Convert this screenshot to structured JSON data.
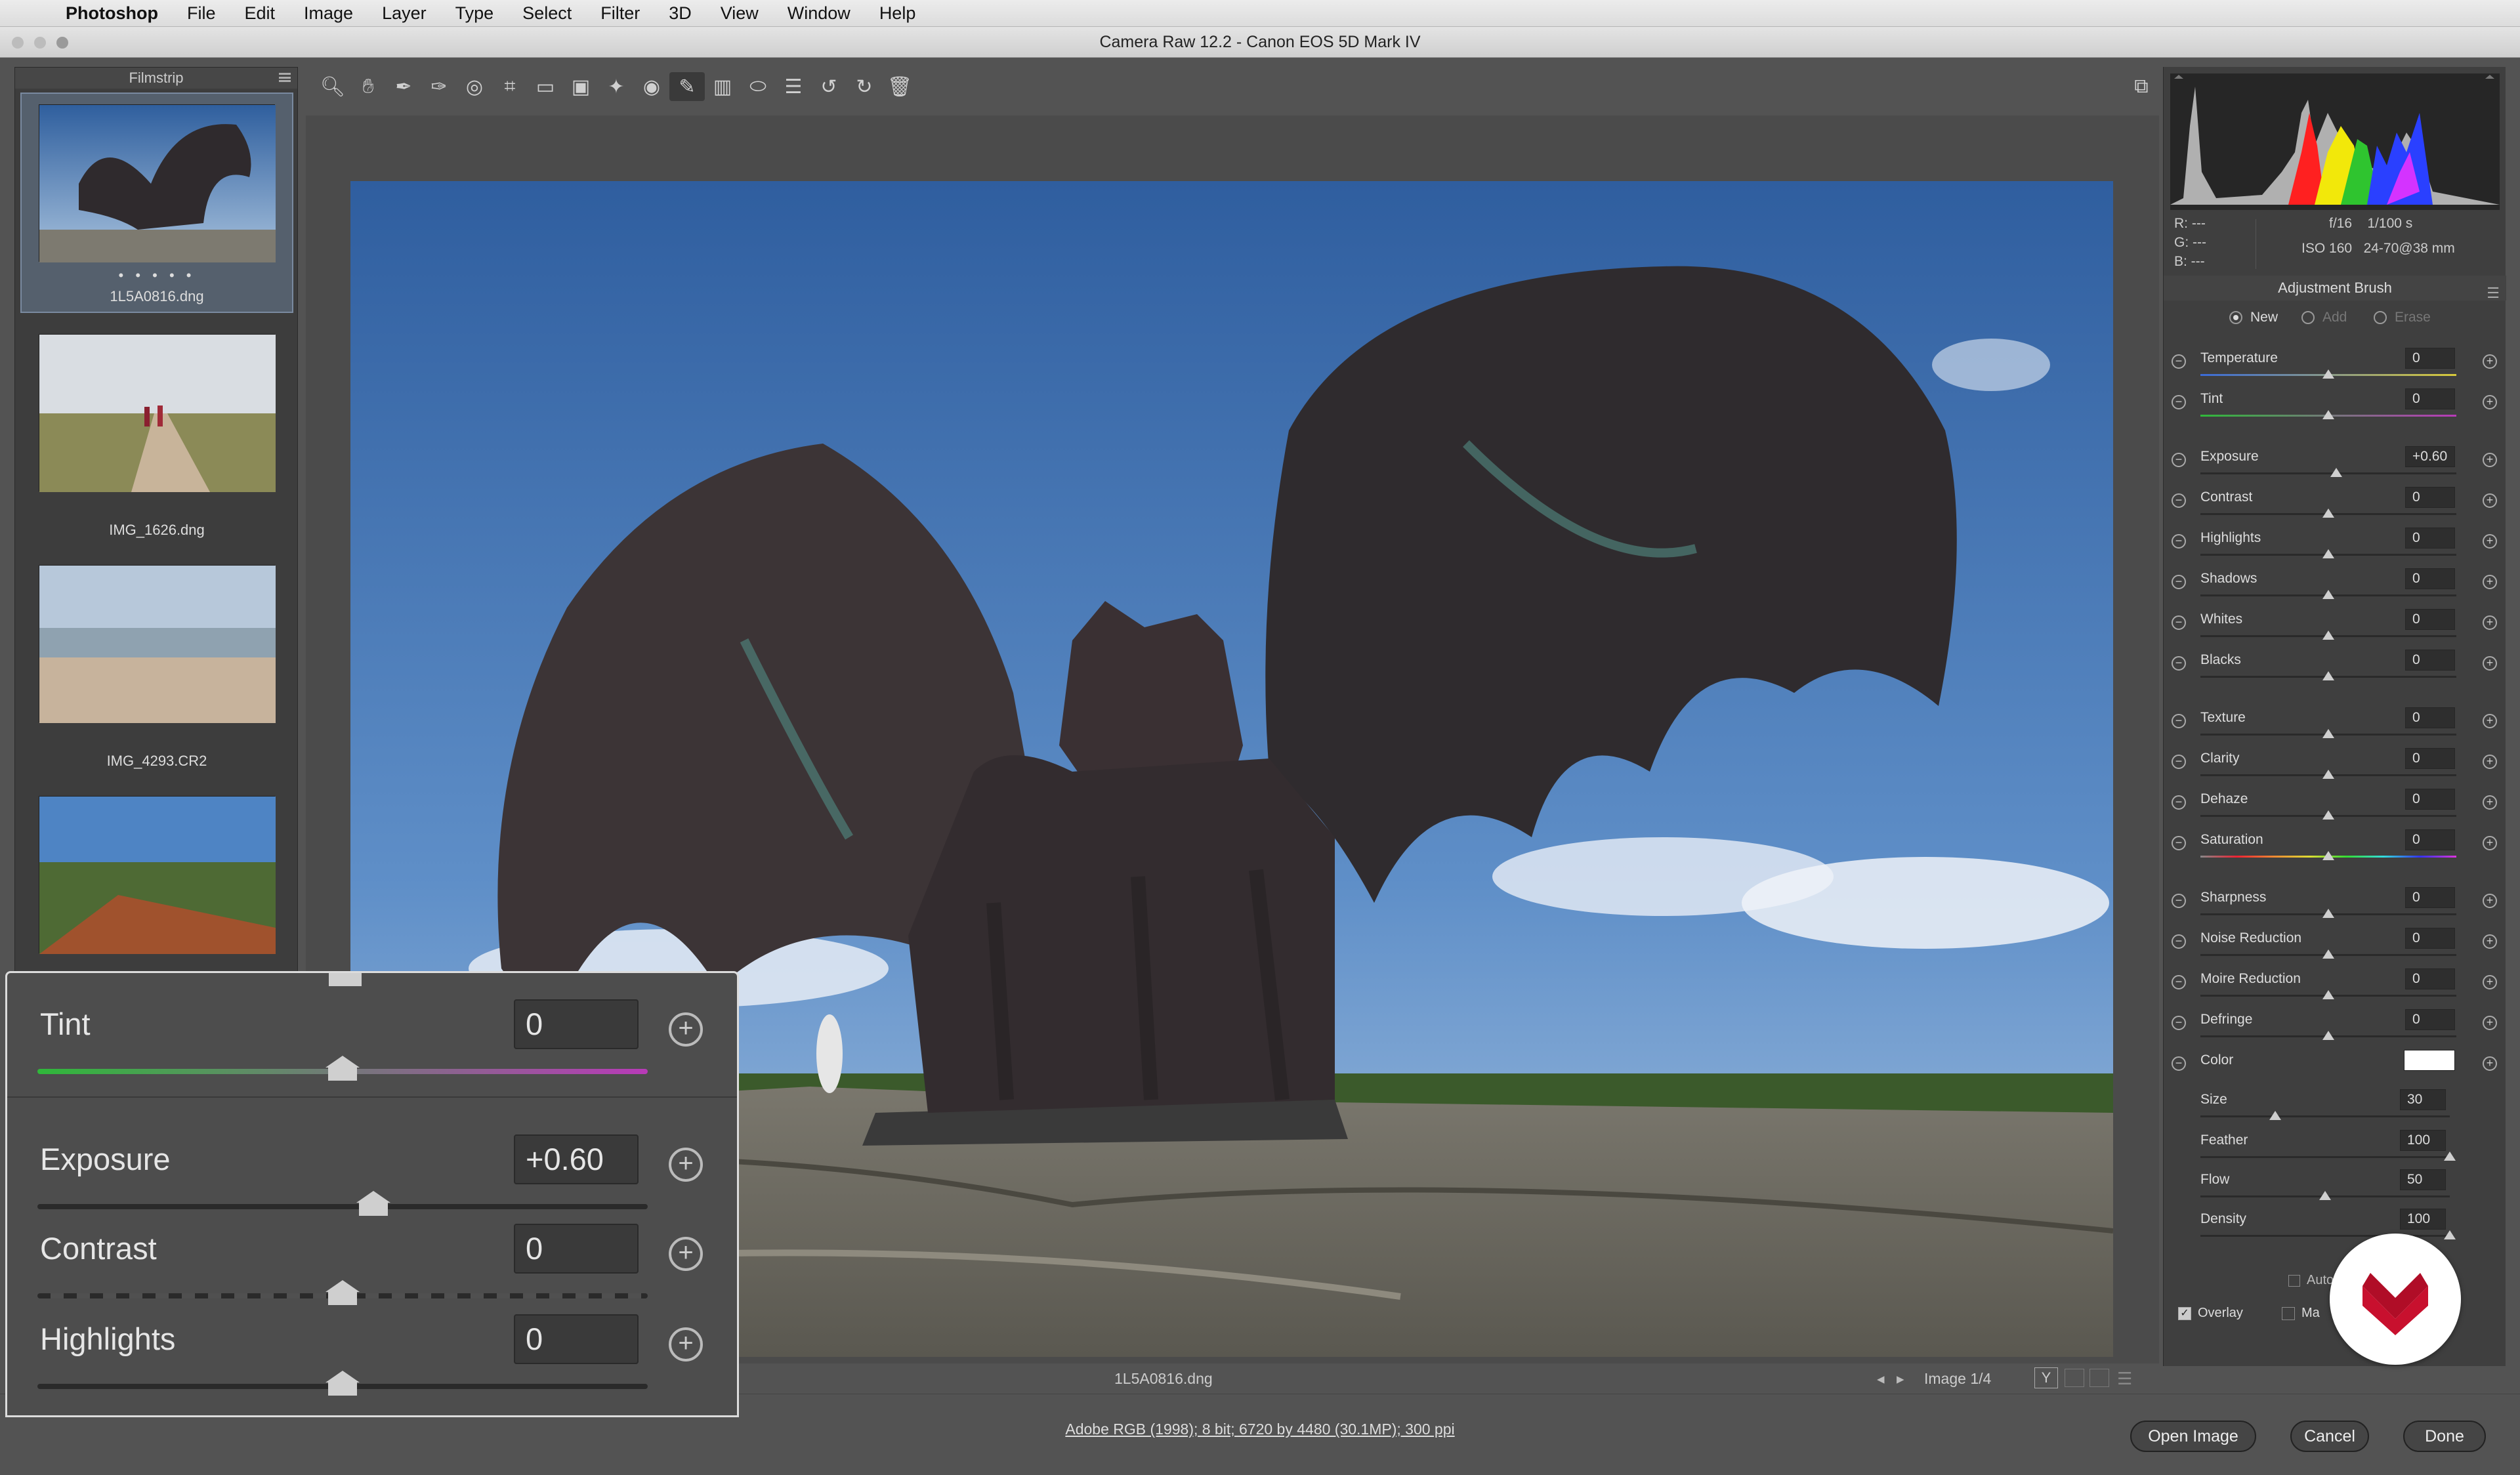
{
  "menubar": {
    "app_name": "Photoshop",
    "items": [
      "File",
      "Edit",
      "Image",
      "Layer",
      "Type",
      "Select",
      "Filter",
      "3D",
      "View",
      "Window",
      "Help"
    ]
  },
  "window": {
    "title": "Camera Raw 12.2  -  Canon EOS 5D Mark IV"
  },
  "filmstrip": {
    "title": "Filmstrip",
    "items": [
      {
        "name": "1L5A0816.dng",
        "rating_dots": "• • • • •",
        "selected": true
      },
      {
        "name": "IMG_1626.dng"
      },
      {
        "name": "IMG_4293.CR2"
      },
      {
        "name": ""
      }
    ]
  },
  "toolbar": {
    "tools": [
      "zoom-icon",
      "hand-icon",
      "white-balance-icon",
      "color-sampler-icon",
      "targeted-adjustment-icon",
      "crop-icon",
      "straighten-icon",
      "transform-icon",
      "spot-removal-icon",
      "red-eye-icon",
      "adjustment-brush-icon",
      "graduated-filter-icon",
      "radial-filter-icon",
      "preferences-icon",
      "rotate-left-icon",
      "rotate-right-icon",
      "trash-icon"
    ],
    "active_tool": "adjustment-brush-icon",
    "fullscreen_icon": "fullscreen-icon"
  },
  "status": {
    "filename": "1L5A0816.dng",
    "image_counter": "Image 1/4",
    "workflow_options": "Adobe RGB (1998); 8 bit; 6720 by 4480 (30.1MP); 300 ppi"
  },
  "info": {
    "r": "R:  ---",
    "g": "G:  ---",
    "b": "B:  ---",
    "aperture": "f/16",
    "shutter": "1/100 s",
    "iso": "ISO 160",
    "lens": "24-70@38 mm"
  },
  "brush_panel": {
    "title": "Adjustment Brush",
    "modes": [
      {
        "label": "New",
        "on": true
      },
      {
        "label": "Add",
        "on": false
      },
      {
        "label": "Erase",
        "on": false
      }
    ],
    "sliders": [
      {
        "label": "Temperature",
        "value": "0",
        "pos": 0.5,
        "track": "temp"
      },
      {
        "label": "Tint",
        "value": "0",
        "pos": 0.5,
        "track": "tint"
      },
      {
        "label": "Exposure",
        "value": "+0.60",
        "pos": 0.53,
        "track": "plain"
      },
      {
        "label": "Contrast",
        "value": "0",
        "pos": 0.5,
        "track": "plain"
      },
      {
        "label": "Highlights",
        "value": "0",
        "pos": 0.5,
        "track": "plain"
      },
      {
        "label": "Shadows",
        "value": "0",
        "pos": 0.5,
        "track": "plain"
      },
      {
        "label": "Whites",
        "value": "0",
        "pos": 0.5,
        "track": "plain"
      },
      {
        "label": "Blacks",
        "value": "0",
        "pos": 0.5,
        "track": "plain"
      },
      {
        "label": "Texture",
        "value": "0",
        "pos": 0.5,
        "track": "plain"
      },
      {
        "label": "Clarity",
        "value": "0",
        "pos": 0.5,
        "track": "plain"
      },
      {
        "label": "Dehaze",
        "value": "0",
        "pos": 0.5,
        "track": "plain"
      },
      {
        "label": "Saturation",
        "value": "0",
        "pos": 0.5,
        "track": "sat"
      },
      {
        "label": "Sharpness",
        "value": "0",
        "pos": 0.5,
        "track": "plain"
      },
      {
        "label": "Noise Reduction",
        "value": "0",
        "pos": 0.5,
        "track": "plain"
      },
      {
        "label": "Moire Reduction",
        "value": "0",
        "pos": 0.5,
        "track": "plain"
      },
      {
        "label": "Defringe",
        "value": "0",
        "pos": 0.5,
        "track": "plain"
      }
    ],
    "color_label": "Color",
    "brush": [
      {
        "label": "Size",
        "value": "30",
        "pos": 0.3
      },
      {
        "label": "Feather",
        "value": "100",
        "pos": 1.0
      },
      {
        "label": "Flow",
        "value": "50",
        "pos": 0.5
      },
      {
        "label": "Density",
        "value": "100",
        "pos": 1.0
      }
    ],
    "auto_mask_label": "Auto",
    "overlay_label": "Overlay",
    "mask_label": "Ma"
  },
  "zoom_callout": {
    "sliders": [
      {
        "label": "Tint",
        "value": "0",
        "pos": 0.5,
        "track": "tint"
      },
      {
        "label": "Exposure",
        "value": "+0.60",
        "pos": 0.55,
        "track": "plain"
      },
      {
        "label": "Contrast",
        "value": "0",
        "pos": 0.5,
        "track": "contrast"
      },
      {
        "label": "Highlights",
        "value": "0",
        "pos": 0.5,
        "track": "plain"
      }
    ]
  },
  "buttons": {
    "open_image": "Open Image",
    "cancel": "Cancel",
    "done": "Done"
  },
  "colors": {
    "panel_bg": "#3f3f3f",
    "app_bg": "#535353",
    "sky": "#3f6faa",
    "logo_red": "#c8102e"
  }
}
